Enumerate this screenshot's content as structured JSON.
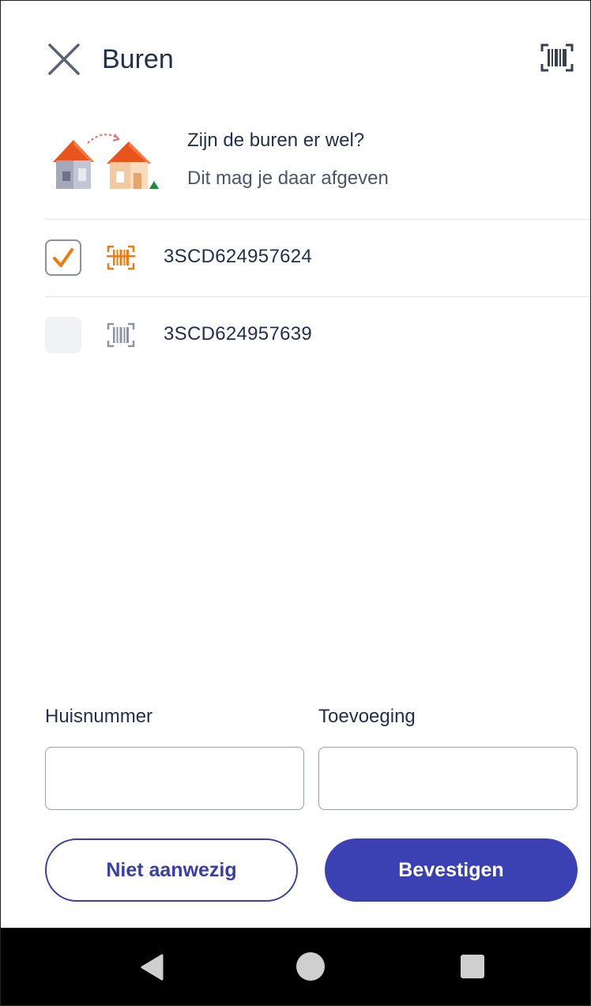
{
  "header": {
    "title": "Buren",
    "close_icon": "close-icon",
    "scan_icon": "barcode-scan-icon"
  },
  "info": {
    "title": "Zijn de buren er wel?",
    "subtitle": "Dit mag je daar afgeven",
    "illustration": "neighbour-houses-illustration"
  },
  "parcels": [
    {
      "code": "3SCD624957624",
      "checked": true,
      "icon": "barcode-icon"
    },
    {
      "code": "3SCD624957639",
      "checked": false,
      "icon": "barcode-icon"
    }
  ],
  "form": {
    "house_number_label": "Huisnummer",
    "house_number_value": "",
    "addition_label": "Toevoeging",
    "addition_value": ""
  },
  "actions": {
    "not_present_label": "Niet aanwezig",
    "confirm_label": "Bevestigen"
  },
  "colors": {
    "accent_orange": "#f07a10",
    "primary_blue": "#3b40b3",
    "text_dark": "#22304d"
  }
}
